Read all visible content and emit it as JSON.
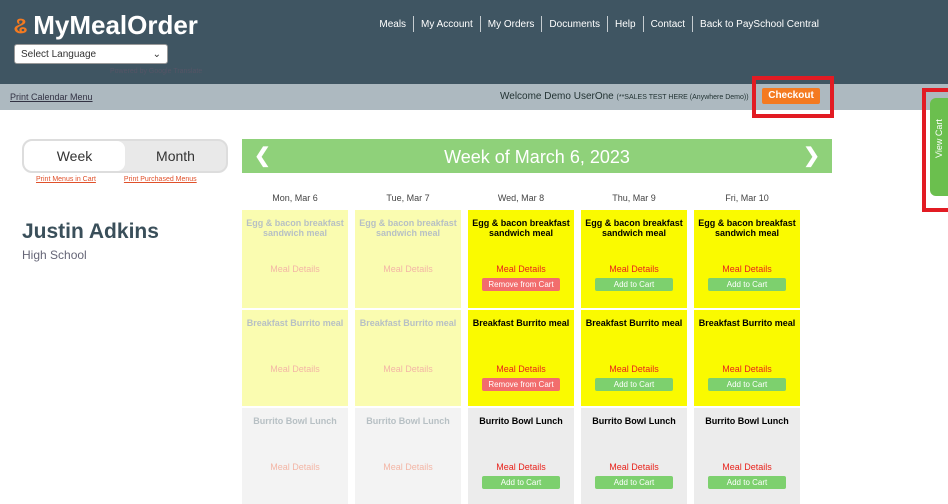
{
  "app": {
    "logo_text": "MyMealOrder",
    "language_select": "Select Language",
    "powered_by": "Powered by Google Translate"
  },
  "topnav": [
    "Meals",
    "My Account",
    "My Orders",
    "Documents",
    "Help",
    "Contact",
    "Back to PaySchool Central"
  ],
  "subbar": {
    "print_calendar": "Print Calendar Menu",
    "welcome": "Welcome Demo UserOne",
    "welcome_note": "(**SALES TEST HERE (Anywhere Demo))",
    "checkout": "Checkout",
    "view_cart": "View Cart"
  },
  "sidebar": {
    "tab_week": "Week",
    "tab_month": "Month",
    "print_cart": "Print Menus in Cart",
    "print_purchased": "Print Purchased Menus",
    "student_name": "Justin Adkins",
    "school": "High School"
  },
  "calendar": {
    "title": "Week of March 6, 2023",
    "prev_icon": "chevron-left-icon",
    "next_icon": "chevron-right-icon",
    "days": [
      {
        "date": "Mon, Mar 6",
        "active": false,
        "meals": [
          {
            "name": "Egg & bacon breakfast sandwich meal",
            "details": "Meal Details",
            "action": ""
          },
          {
            "name": "Breakfast Burrito meal",
            "details": "Meal Details",
            "action": ""
          },
          {
            "name": "Burrito Bowl Lunch",
            "details": "Meal Details",
            "action": ""
          }
        ]
      },
      {
        "date": "Tue, Mar 7",
        "active": false,
        "meals": [
          {
            "name": "Egg & bacon breakfast sandwich meal",
            "details": "Meal Details",
            "action": ""
          },
          {
            "name": "Breakfast Burrito meal",
            "details": "Meal Details",
            "action": ""
          },
          {
            "name": "Burrito Bowl Lunch",
            "details": "Meal Details",
            "action": ""
          }
        ]
      },
      {
        "date": "Wed, Mar 8",
        "active": true,
        "meals": [
          {
            "name": "Egg & bacon breakfast sandwich meal",
            "details": "Meal Details",
            "action": "Remove from Cart"
          },
          {
            "name": "Breakfast Burrito meal",
            "details": "Meal Details",
            "action": "Remove from Cart"
          },
          {
            "name": "Burrito Bowl Lunch",
            "details": "Meal Details",
            "action": "Add to Cart"
          }
        ]
      },
      {
        "date": "Thu, Mar 9",
        "active": true,
        "meals": [
          {
            "name": "Egg & bacon breakfast sandwich meal",
            "details": "Meal Details",
            "action": "Add to Cart"
          },
          {
            "name": "Breakfast Burrito meal",
            "details": "Meal Details",
            "action": "Add to Cart"
          },
          {
            "name": "Burrito Bowl Lunch",
            "details": "Meal Details",
            "action": "Add to Cart"
          }
        ]
      },
      {
        "date": "Fri, Mar 10",
        "active": true,
        "meals": [
          {
            "name": "Egg & bacon breakfast sandwich meal",
            "details": "Meal Details",
            "action": "Add to Cart"
          },
          {
            "name": "Breakfast Burrito meal",
            "details": "Meal Details",
            "action": "Add to Cart"
          },
          {
            "name": "Burrito Bowl Lunch",
            "details": "Meal Details",
            "action": "Add to Cart"
          }
        ]
      }
    ]
  },
  "colors": {
    "header": "#3f5562",
    "accent": "#f47a20",
    "calendar_bar": "#8fd17a",
    "highlight_red": "#e21b23"
  }
}
